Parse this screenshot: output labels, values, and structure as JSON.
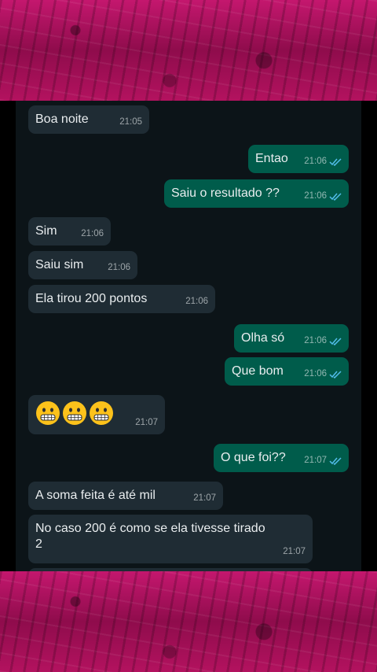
{
  "messages": [
    {
      "dir": "in",
      "text": "Boa noite",
      "time": "21:05"
    },
    {
      "dir": "out",
      "text": "Entao",
      "time": "21:06"
    },
    {
      "dir": "out",
      "text": "Saiu o resultado ??",
      "time": "21:06"
    },
    {
      "dir": "in",
      "text": "Sim",
      "time": "21:06"
    },
    {
      "dir": "in",
      "text": "Saiu sim",
      "time": "21:06"
    },
    {
      "dir": "in",
      "text": "Ela tirou 200 pontos",
      "time": "21:06"
    },
    {
      "dir": "out",
      "text": "Olha só",
      "time": "21:06"
    },
    {
      "dir": "out",
      "text": "Que bom",
      "time": "21:06"
    },
    {
      "dir": "in",
      "emoji": [
        "grimacing-face",
        "grimacing-face",
        "grimacing-face"
      ],
      "time": "21:07"
    },
    {
      "dir": "out",
      "text": "O que foi??",
      "time": "21:07"
    },
    {
      "dir": "in",
      "text": "A soma feita é até mil",
      "time": "21:07"
    },
    {
      "dir": "in",
      "text": "No caso 200 é como se ela tivesse tirado\n2",
      "time": "21:07"
    }
  ],
  "colors": {
    "background_magenta": "#b0125f",
    "chat_background": "#0c1418",
    "incoming_bubble": "#1f2c34",
    "outgoing_bubble": "#005c4b",
    "read_ticks": "#53bdeb"
  },
  "icons": {
    "read_receipt": "double-check-icon",
    "emoji": "grimacing-face-emoji"
  }
}
